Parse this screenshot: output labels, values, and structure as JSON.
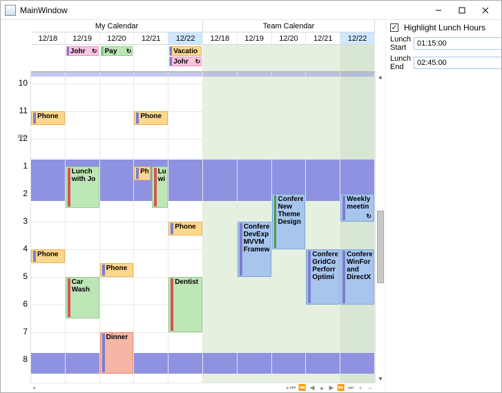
{
  "window": {
    "title": "MainWindow"
  },
  "groups": [
    {
      "name": "My Calendar"
    },
    {
      "name": "Team Calendar"
    }
  ],
  "days": [
    "12/18",
    "12/19",
    "12/20",
    "12/21",
    "12/22"
  ],
  "today_index": 4,
  "ruler": {
    "hours": [
      10,
      11,
      12,
      1,
      2,
      3,
      4,
      5,
      6,
      7,
      8
    ],
    "noon_suffix": "PM"
  },
  "side": {
    "highlight_label": "Highlight Lunch Hours",
    "highlight_checked": true,
    "lunch_start_label": "Lunch Start",
    "lunch_start_value": "01:15:00",
    "lunch_end_label": "Lunch End",
    "lunch_end_value": "02:45:00"
  },
  "allday": {
    "my": [
      [],
      [
        {
          "label": "Johr",
          "color": "pink",
          "bar": "b",
          "recur": true
        }
      ],
      [
        {
          "label": "Pay",
          "color": "green",
          "bar": "g",
          "recur": true
        }
      ],
      [],
      [
        {
          "label": "Vacatio",
          "color": "orange",
          "bar": "b",
          "recur": false
        },
        {
          "label": "Johr",
          "color": "pink",
          "bar": "b",
          "recur": true
        }
      ]
    ],
    "team": [
      [],
      [],
      [],
      [],
      []
    ]
  },
  "lunch": {
    "start_hour": 0.75,
    "duration_hours": 1.5,
    "extra_half_at_end": true
  },
  "timed": {
    "my": [
      {
        "day": 0,
        "label": "Phone",
        "color": "orange",
        "bar": "b",
        "start": 11.0,
        "end": 11.5
      },
      {
        "day": 0,
        "label": "Phone",
        "color": "orange",
        "bar": "b",
        "start": 16.0,
        "end": 16.5
      },
      {
        "day": 1,
        "label": "Lunch\nwith Jo",
        "color": "green",
        "bar": "r",
        "start": 13.0,
        "end": 14.5
      },
      {
        "day": 1,
        "label": "Car\nWash",
        "color": "green",
        "bar": "r",
        "start": 17.0,
        "end": 18.5
      },
      {
        "day": 2,
        "label": "Phone",
        "color": "orange",
        "bar": "b",
        "start": 16.5,
        "end": 17.0
      },
      {
        "day": 2,
        "label": "Dinner",
        "color": "salmon",
        "bar": "b",
        "start": 19.0,
        "end": 20.5
      },
      {
        "day": 3,
        "label": "Phone",
        "color": "orange",
        "bar": "b",
        "start": 11.0,
        "end": 11.5
      },
      {
        "day": 3,
        "label": "Ph",
        "color": "orange",
        "bar": "b",
        "start": 13.0,
        "end": 13.5,
        "half": "left"
      },
      {
        "day": 3,
        "label": "Lu\nwi",
        "color": "green",
        "bar": "r",
        "start": 13.0,
        "end": 14.5,
        "half": "right"
      },
      {
        "day": 4,
        "label": "Phone",
        "color": "orange",
        "bar": "b",
        "start": 15.0,
        "end": 15.5
      },
      {
        "day": 4,
        "label": "Dentist",
        "color": "green",
        "bar": "r",
        "start": 17.0,
        "end": 19.0
      }
    ],
    "team": [
      {
        "day": 1,
        "label": "Confere\nDevExp\nMVVM\nFramew",
        "color": "blue",
        "bar": "b",
        "start": 15.0,
        "end": 17.0
      },
      {
        "day": 2,
        "label": "Confere\nNew\nTheme\nDesign",
        "color": "blue",
        "bar": "dg",
        "start": 14.0,
        "end": 16.0
      },
      {
        "day": 3,
        "label": "Confere\nGridCo\nPerforr\nOptimi",
        "color": "blue",
        "bar": "b",
        "start": 16.0,
        "end": 18.0
      },
      {
        "day": 4,
        "label": "Weekly\nmeetin",
        "color": "blue",
        "bar": "b",
        "start": 14.0,
        "end": 15.0,
        "recur": true
      },
      {
        "day": 4,
        "label": "Confere\nWinFor\nand\nDirectX",
        "color": "blue",
        "bar": "b",
        "start": 16.0,
        "end": 18.0
      }
    ]
  }
}
